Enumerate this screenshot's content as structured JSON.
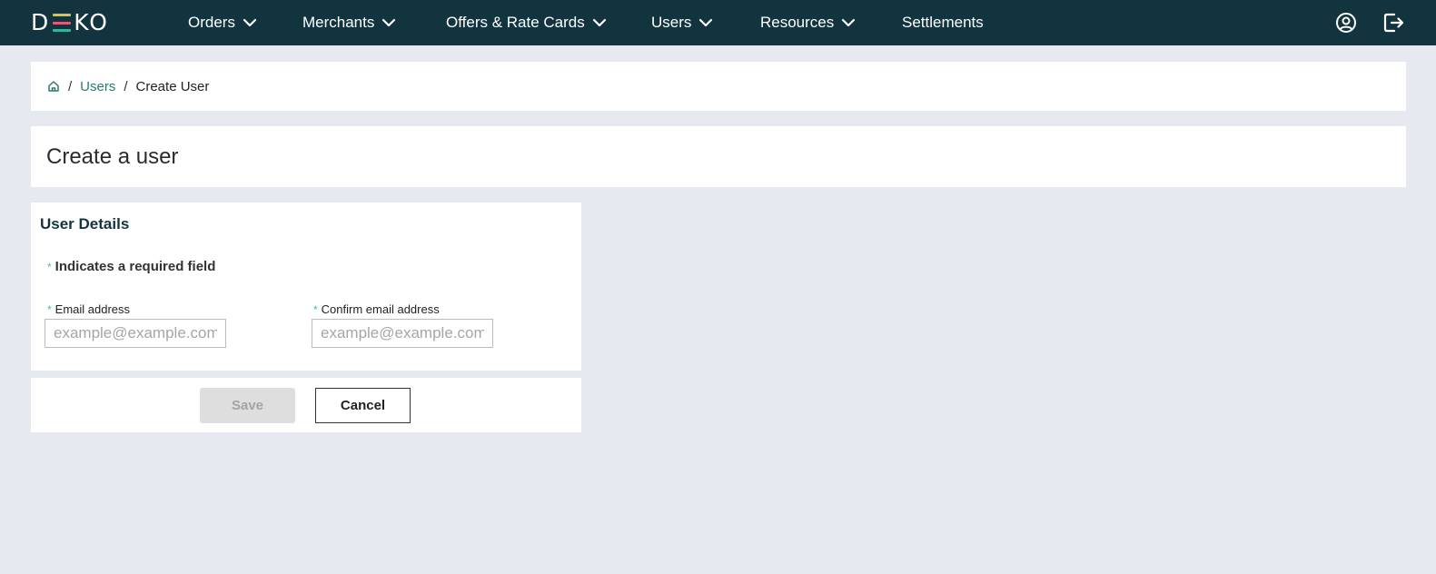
{
  "colors": {
    "header_bg": "#12343f",
    "page_bg": "#e6e9ef",
    "accent_link": "#2a7a6c",
    "required_marker": "#3cc0a6",
    "logo_bars": [
      "#d9c34a",
      "#e05a7a",
      "#36b39a"
    ]
  },
  "header": {
    "logo": {
      "left": "D",
      "right": "KO"
    },
    "nav": [
      {
        "label": "Orders",
        "icon": "chevron-down-icon"
      },
      {
        "label": "Merchants",
        "icon": "chevron-down-icon"
      },
      {
        "label": "Offers & Rate Cards",
        "icon": "chevron-down-icon"
      },
      {
        "label": "Users",
        "icon": "chevron-down-icon"
      },
      {
        "label": "Resources",
        "icon": "chevron-down-icon"
      },
      {
        "label": "Settlements"
      }
    ],
    "icons": [
      "user-account-icon",
      "logout-icon"
    ]
  },
  "breadcrumb": {
    "home_icon": "home-icon",
    "separator": "/",
    "items": [
      "Users",
      "Create User"
    ]
  },
  "page": {
    "title": "Create a user"
  },
  "form": {
    "section_title": "User Details",
    "required_marker": "*",
    "required_note": "Indicates a required field",
    "email": {
      "label": "Email address",
      "placeholder": "example@example.com",
      "value": ""
    },
    "confirm_email": {
      "label": "Confirm email address",
      "placeholder": "example@example.com",
      "value": ""
    }
  },
  "actions": {
    "save_label": "Save",
    "save_disabled": true,
    "cancel_label": "Cancel"
  }
}
